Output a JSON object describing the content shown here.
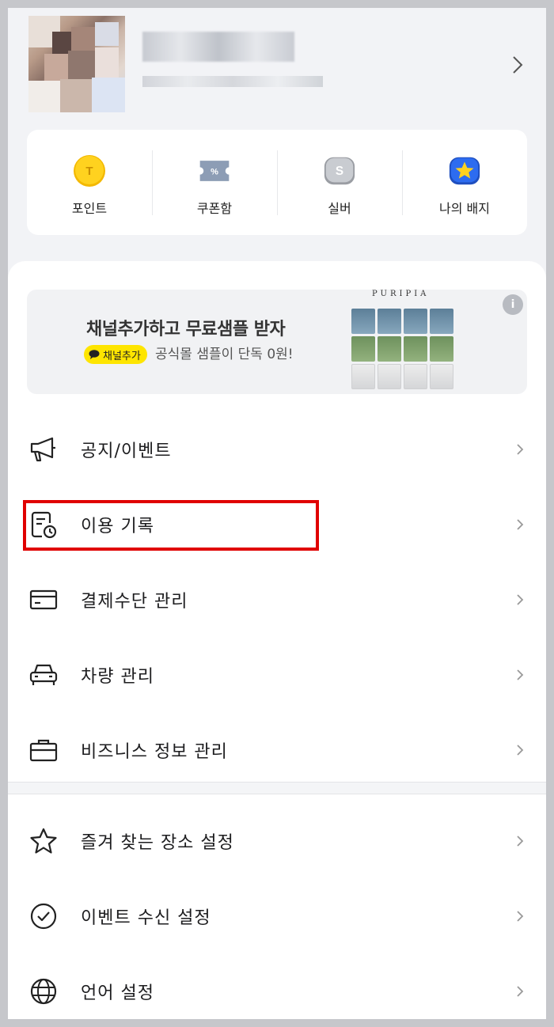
{
  "quick_menu": [
    {
      "label": "포인트",
      "icon": "point-coin-icon"
    },
    {
      "label": "쿠폰함",
      "icon": "coupon-icon"
    },
    {
      "label": "실버",
      "icon": "silver-badge-icon"
    },
    {
      "label": "나의 배지",
      "icon": "star-badge-icon"
    }
  ],
  "banner": {
    "title": "채널추가하고 무료샘플 받자",
    "pill": "채널추가",
    "subtitle": "공식몰 샘플이 단독 0원!",
    "brand": "PURIPIA"
  },
  "menu_group1": [
    {
      "label": "공지/이벤트",
      "icon": "megaphone-icon"
    },
    {
      "label": "이용 기록",
      "icon": "history-icon"
    },
    {
      "label": "결제수단 관리",
      "icon": "card-icon"
    },
    {
      "label": "차량 관리",
      "icon": "car-icon"
    },
    {
      "label": "비즈니스 정보 관리",
      "icon": "briefcase-icon"
    }
  ],
  "menu_group2": [
    {
      "label": "즐겨 찾는 장소 설정",
      "icon": "star-icon"
    },
    {
      "label": "이벤트 수신 설정",
      "icon": "check-circle-icon"
    },
    {
      "label": "언어 설정",
      "icon": "globe-icon"
    }
  ],
  "colors": {
    "highlight": "#e00000",
    "kakao_yellow": "#fee500",
    "badge_blue": "#2d6cf0",
    "point_yellow": "#f8c400"
  }
}
